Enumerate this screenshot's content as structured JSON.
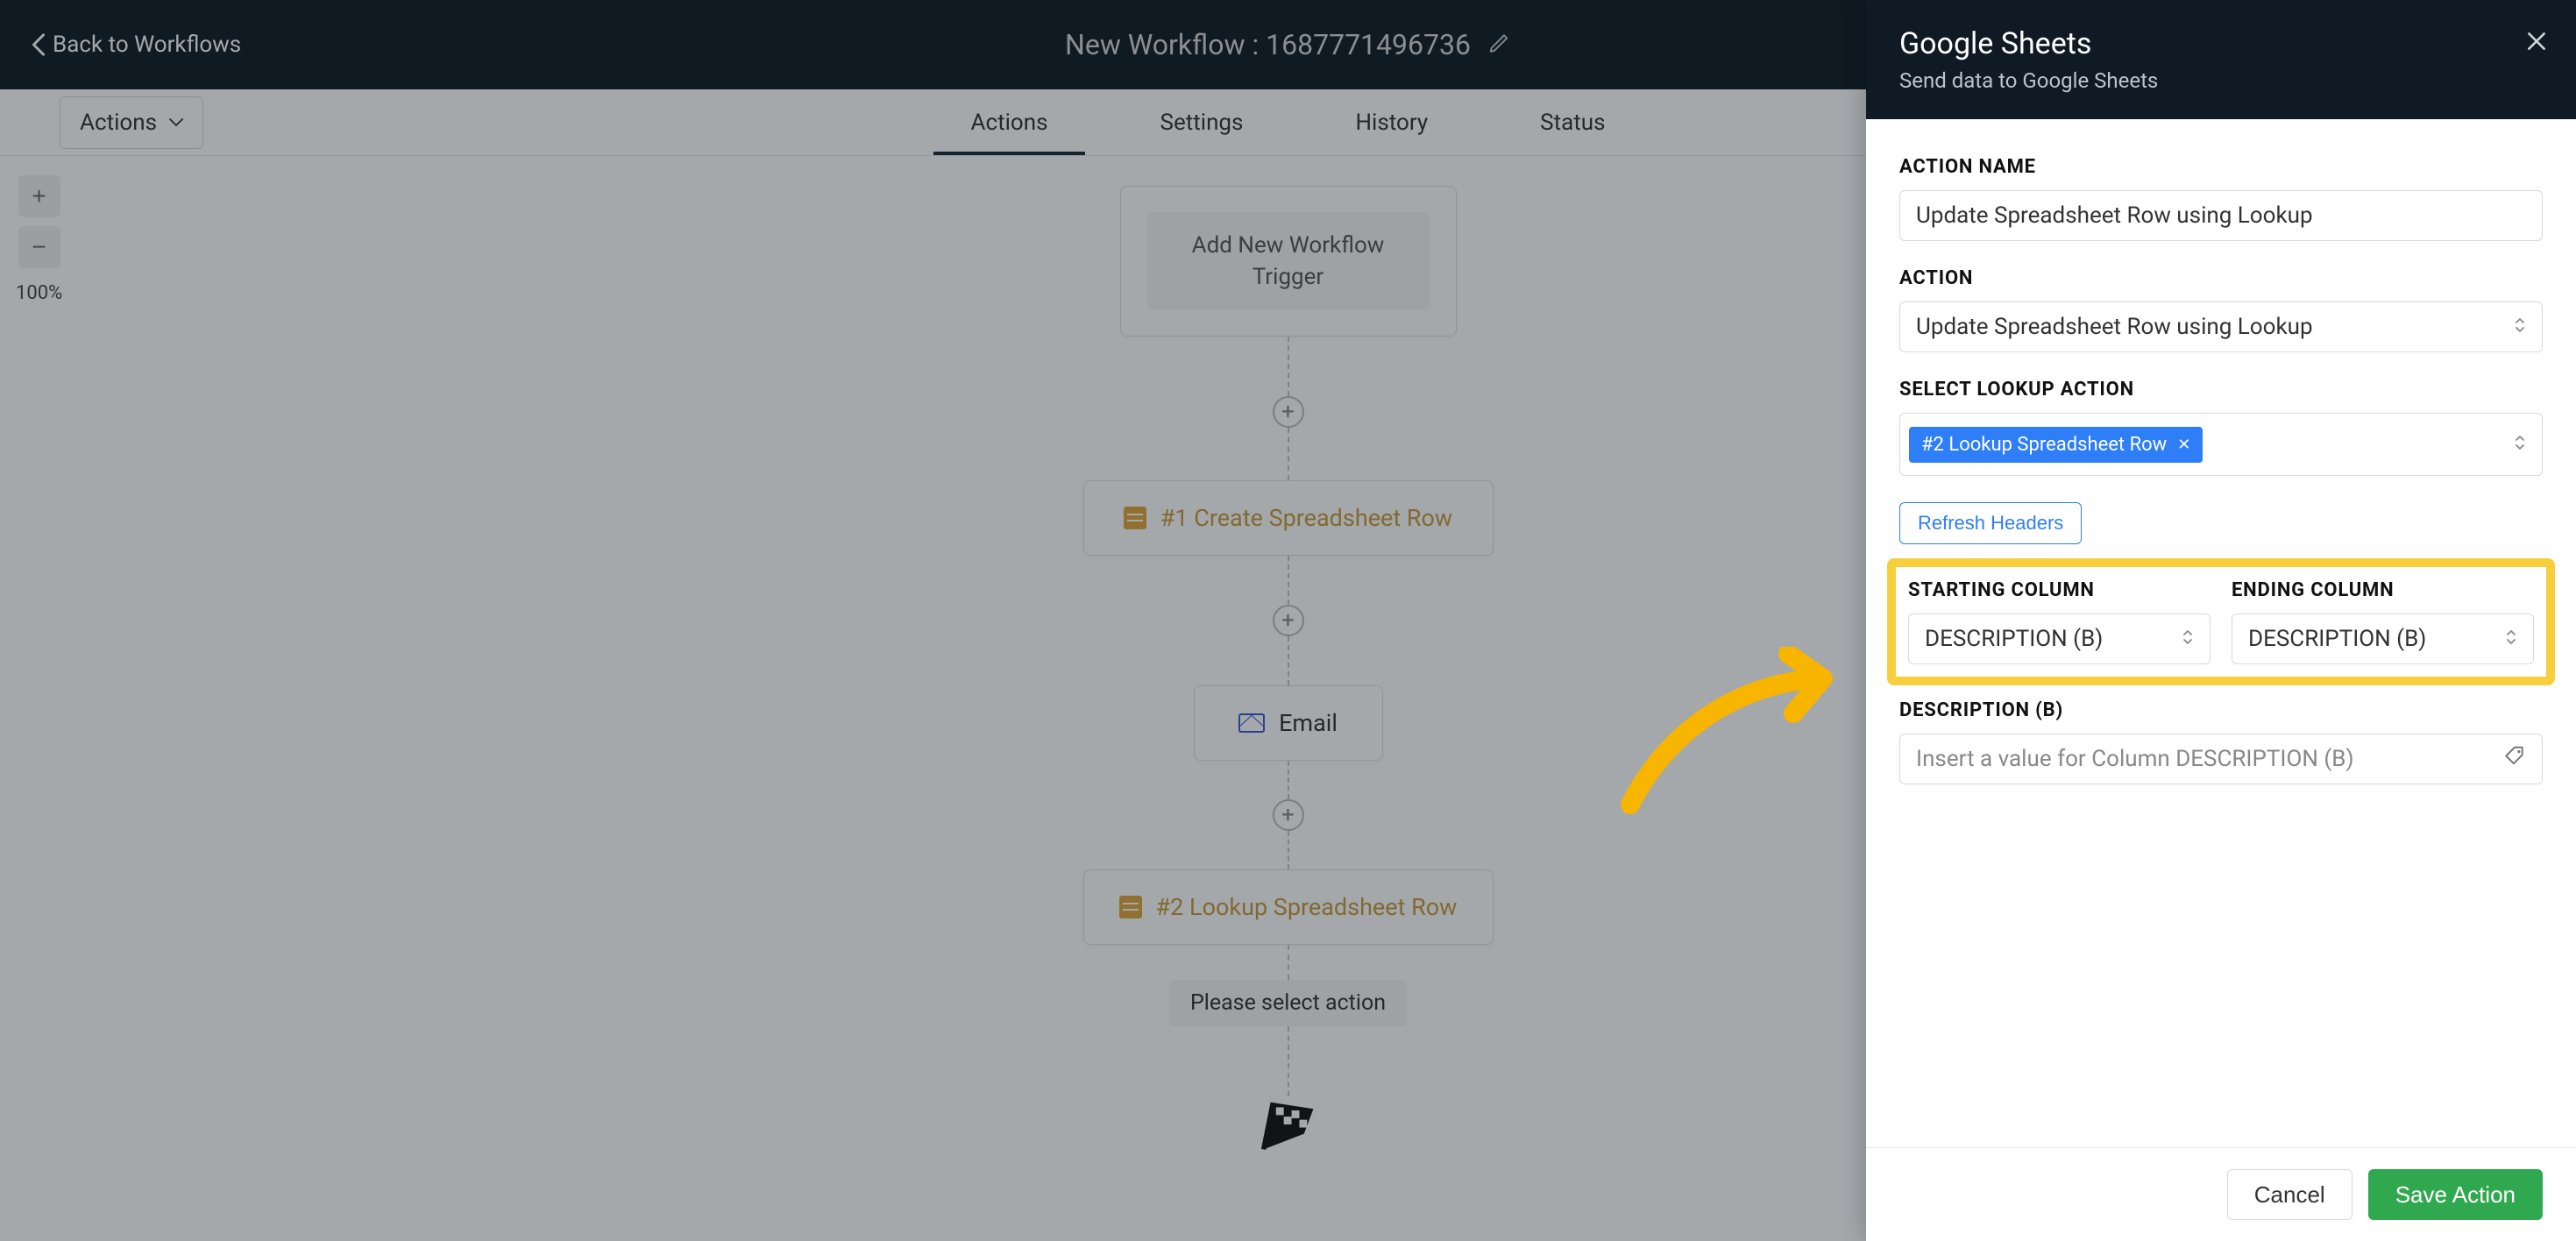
{
  "header": {
    "back_label": "Back to Workflows",
    "title": "New Workflow : 1687771496736"
  },
  "secondbar": {
    "actions_menu": "Actions",
    "tabs": [
      "Actions",
      "Settings",
      "History",
      "Status"
    ],
    "active_tab_index": 0
  },
  "zoom": {
    "percent": "100%"
  },
  "flow": {
    "trigger_label": "Add New Workflow Trigger",
    "nodes": [
      {
        "kind": "sheet",
        "label": "#1 Create Spreadsheet Row"
      },
      {
        "kind": "email",
        "label": "Email"
      },
      {
        "kind": "sheet",
        "label": "#2 Lookup Spreadsheet Row"
      }
    ],
    "select_action": "Please select action"
  },
  "panel": {
    "title": "Google Sheets",
    "subtitle": "Send data to Google Sheets",
    "fields": {
      "action_name_label": "Action Name",
      "action_name_value": "Update Spreadsheet Row using Lookup",
      "action_label": "Action",
      "action_value": "Update Spreadsheet Row using Lookup",
      "select_lookup_label": "Select Lookup Action",
      "lookup_chip": "#2 Lookup Spreadsheet Row",
      "refresh_headers": "Refresh Headers",
      "starting_col_label": "Starting Column",
      "starting_col_value": "DESCRIPTION (B)",
      "ending_col_label": "Ending Column",
      "ending_col_value": "DESCRIPTION (B)",
      "desc_b_label": "Description (B)",
      "desc_b_placeholder": "Insert a value for Column DESCRIPTION (B)"
    },
    "footer": {
      "cancel": "Cancel",
      "save": "Save Action"
    }
  }
}
